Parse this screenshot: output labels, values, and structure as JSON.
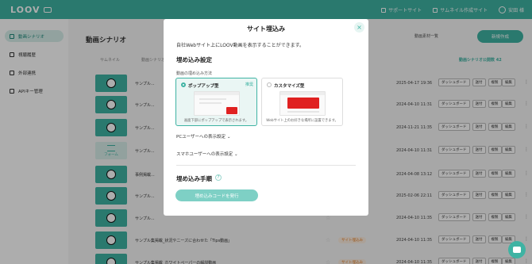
{
  "header": {
    "logo": "LOOV",
    "links": [
      "サポートサイト",
      "サムネイル作成サイト"
    ],
    "user": "安田 様"
  },
  "sidebar": {
    "items": [
      {
        "label": "動画シナリオ",
        "active": true
      },
      {
        "label": "視聴履歴"
      },
      {
        "label": "外部連携"
      },
      {
        "label": "APIキー管理"
      }
    ]
  },
  "main": {
    "title": "動画シナリオ",
    "list_button": "動画素材一覧",
    "create_button": "新規作成",
    "columns": [
      "サムネイル",
      "動画シナリオ名",
      "動画シナリオ公開数 42"
    ],
    "rows": [
      {
        "name": "サンプル...",
        "date": "2025-04-17 19:36",
        "thumb": "video",
        "tag": ""
      },
      {
        "name": "サンプル...",
        "date": "2024-04-10 11:31",
        "thumb": "video",
        "tag": ""
      },
      {
        "name": "サンプル...",
        "date": "2024-11-21 11:35",
        "thumb": "video",
        "tag": ""
      },
      {
        "name": "サンプル...",
        "date": "2024-04-10 11:31",
        "thumb": "form",
        "tag": ""
      },
      {
        "name": "事例掲載...",
        "date": "2024-04-08 13:12",
        "thumb": "video",
        "tag": ""
      },
      {
        "name": "サンプル...",
        "date": "2025-02-06 22:11",
        "thumb": "video",
        "tag": ""
      },
      {
        "name": "サンプル...",
        "date": "2024-04-10 11:35",
        "thumb": "video",
        "tag": ""
      },
      {
        "name": "サンプル集掲載_状況やニーズに合わせた「Tips動画」",
        "date": "2024-04-10 11:35",
        "thumb": "video",
        "tag": "サイト埋込み"
      },
      {
        "name": "サンプル集掲載_ホワイトペーパーの解説動画",
        "date": "2024-04-10 11:35",
        "thumb": "video",
        "tag": "サイト埋込み"
      }
    ],
    "row_buttons": [
      "ダッシュボード",
      "送付",
      "複製"
    ],
    "edit_label": "編集",
    "form_thumb_label": "フォーム"
  },
  "modal": {
    "title": "サイト埋込み",
    "intro": "自社Webサイト上にLOOV動画を表示することができます。",
    "section_title": "埋め込み設定",
    "method_label": "動画の埋め込み方法",
    "options": [
      {
        "name": "ポップアップ型",
        "badge": "推奨",
        "desc": "画面下部にポップアップで表示されます。",
        "selected": true
      },
      {
        "name": "カスタマイズ型",
        "badge": "",
        "desc": "Webサイト上のお好きな場所に設置できます。",
        "selected": false
      }
    ],
    "pc_toggle": "PCユーザーへの表示設定",
    "sp_toggle": "スマホユーザーへの表示設定",
    "steps_title": "埋め込み手順",
    "issue_button": "埋め込みコードを発行",
    "close_symbol": "×"
  },
  "colors": {
    "brand": "#3fb3a3",
    "accent_red": "#e02020",
    "overlay": "rgba(0,0,0,0.32)"
  }
}
